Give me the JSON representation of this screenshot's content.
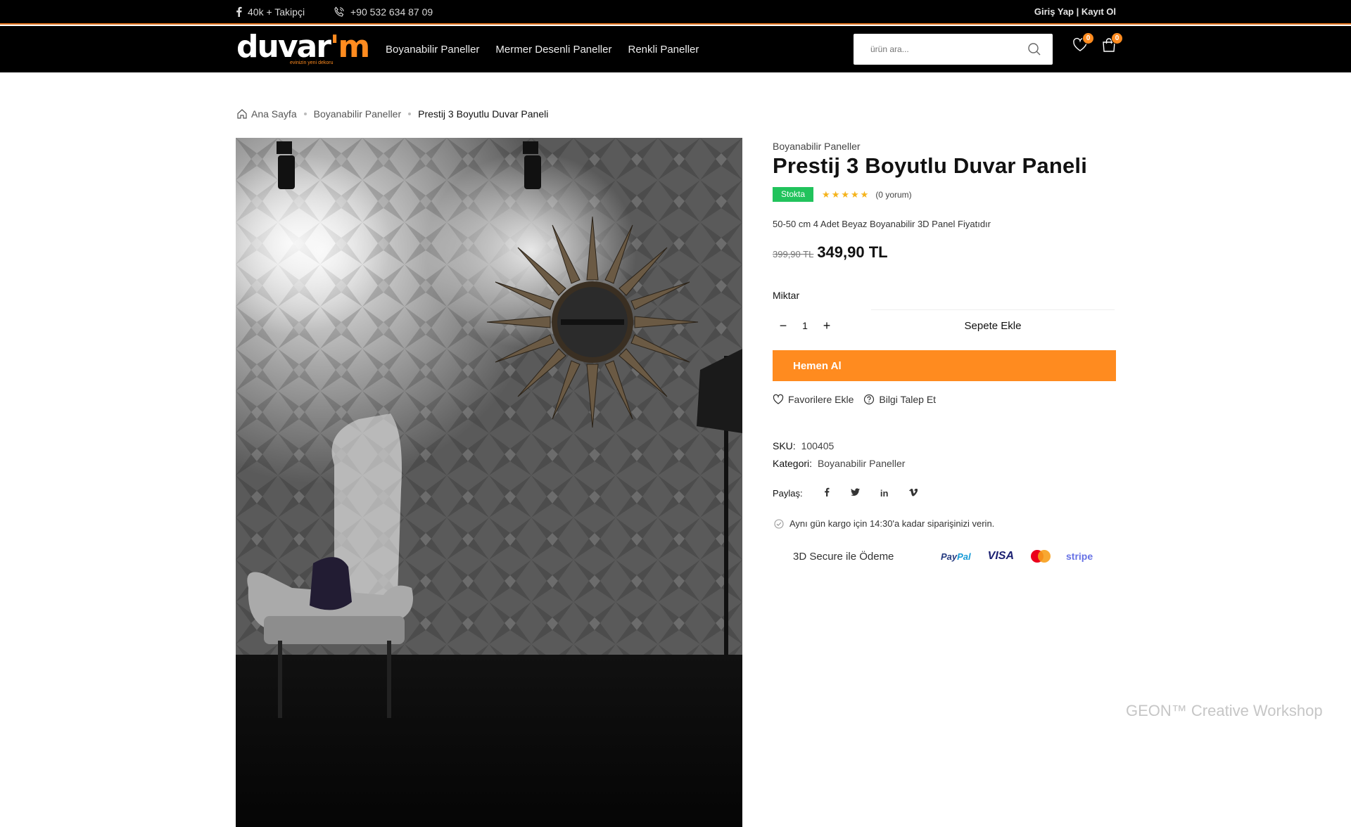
{
  "topbar": {
    "followers": "40k + Takipçi",
    "phone": "+90 532 634 87 09",
    "auth": "Giriş Yap | Kayıt Ol"
  },
  "header": {
    "logo_text": "duvar",
    "logo_accent": "'m",
    "logo_tagline": "evinizin yeni dekoru",
    "nav": [
      "Boyanabilir Paneller",
      "Mermer Desenli Paneller",
      "Renkli Paneller"
    ],
    "search_placeholder": "ürün ara...",
    "wishlist_count": "0",
    "cart_count": "0"
  },
  "breadcrumb": {
    "home": "Ana Sayfa",
    "category": "Boyanabilir Paneller",
    "current": "Prestij 3 Boyutlu Duvar Paneli"
  },
  "product": {
    "category": "Boyanabilir Paneller",
    "title": "Prestij 3 Boyutlu Duvar Paneli",
    "stock": "Stokta",
    "rating": 5,
    "reviews": "(0 yorum)",
    "short_description": "50-50 cm 4 Adet Beyaz Boyanabilir 3D Panel Fiyatıdır",
    "old_price": "399,90 TL",
    "price": "349,90 TL",
    "quantity_label": "Miktar",
    "quantity": "1",
    "add_to_cart": "Sepete Ekle",
    "buy_now": "Hemen Al",
    "wishlist": "Favorilere Ekle",
    "inquiry": "Bilgi Talep Et",
    "sku_label": "SKU:",
    "sku": "100405",
    "category_label": "Kategori:",
    "category_value": "Boyanabilir Paneller",
    "share_label": "Paylaş:",
    "share_icons": [
      "facebook-icon",
      "twitter-icon",
      "linkedin-icon",
      "vimeo-icon"
    ],
    "shipping_note": "Aynı gün kargo için 14:30'a kadar siparişinizi verin.",
    "secure_payment": "3D Secure ile Ödeme",
    "payment_logos": {
      "paypal_1": "Pay",
      "paypal_2": "Pal",
      "visa": "VISA",
      "stripe": "stripe"
    }
  },
  "colors": {
    "accent": "#ff8b1f",
    "stock_green": "#21c35c",
    "header_bg": "#000000"
  },
  "watermark": "GEON™ Creative Workshop"
}
